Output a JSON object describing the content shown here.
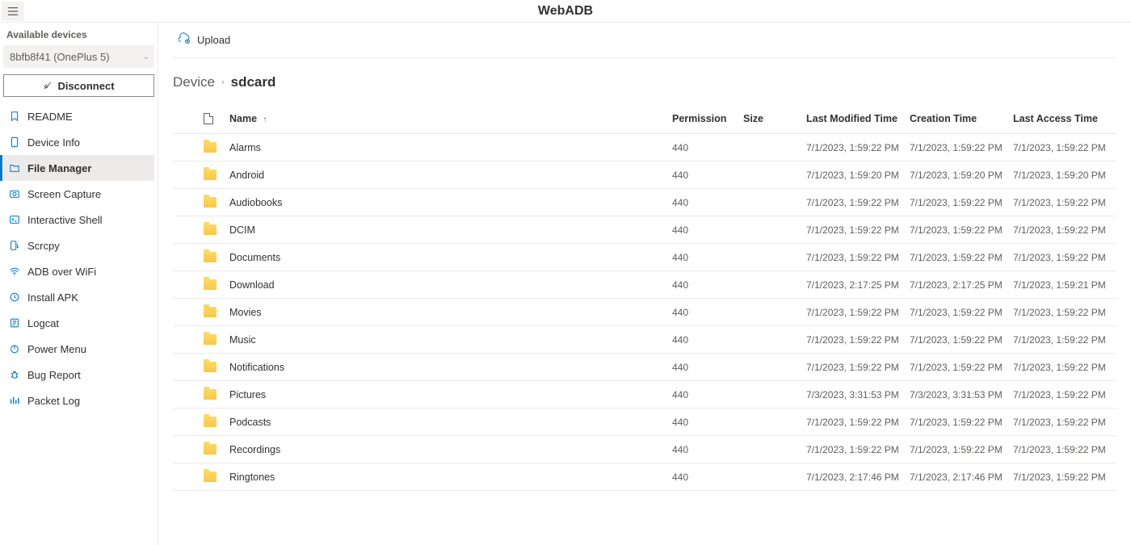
{
  "header": {
    "title": "WebADB"
  },
  "sidebar": {
    "available_label": "Available devices",
    "selected_device": "8bfb8f41 (OnePlus 5)",
    "disconnect_label": "Disconnect",
    "nav": [
      {
        "id": "readme",
        "label": "README",
        "icon": "bookmark-icon"
      },
      {
        "id": "device-info",
        "label": "Device Info",
        "icon": "phone-icon"
      },
      {
        "id": "file-manager",
        "label": "File Manager",
        "icon": "folder-icon",
        "active": true
      },
      {
        "id": "screen-capture",
        "label": "Screen Capture",
        "icon": "camera-icon"
      },
      {
        "id": "interactive-shell",
        "label": "Interactive Shell",
        "icon": "terminal-icon"
      },
      {
        "id": "scrcpy",
        "label": "Scrcpy",
        "icon": "phone-link-icon"
      },
      {
        "id": "adb-over-wifi",
        "label": "ADB over WiFi",
        "icon": "wifi-icon"
      },
      {
        "id": "install-apk",
        "label": "Install APK",
        "icon": "package-icon"
      },
      {
        "id": "logcat",
        "label": "Logcat",
        "icon": "log-icon"
      },
      {
        "id": "power-menu",
        "label": "Power Menu",
        "icon": "power-icon"
      },
      {
        "id": "bug-report",
        "label": "Bug Report",
        "icon": "bug-icon"
      },
      {
        "id": "packet-log",
        "label": "Packet Log",
        "icon": "network-icon"
      }
    ]
  },
  "toolbar": {
    "upload_label": "Upload"
  },
  "breadcrumb": {
    "root_label": "Device",
    "current_label": "sdcard"
  },
  "table": {
    "columns": {
      "name": "Name",
      "permission": "Permission",
      "size": "Size",
      "last_modified": "Last Modified Time",
      "creation": "Creation Time",
      "last_access": "Last Access Time"
    },
    "rows": [
      {
        "name": "Alarms",
        "permission": "440",
        "size": "",
        "lastModified": "7/1/2023, 1:59:22 PM",
        "creation": "7/1/2023, 1:59:22 PM",
        "lastAccess": "7/1/2023, 1:59:22 PM"
      },
      {
        "name": "Android",
        "permission": "440",
        "size": "",
        "lastModified": "7/1/2023, 1:59:20 PM",
        "creation": "7/1/2023, 1:59:20 PM",
        "lastAccess": "7/1/2023, 1:59:20 PM"
      },
      {
        "name": "Audiobooks",
        "permission": "440",
        "size": "",
        "lastModified": "7/1/2023, 1:59:22 PM",
        "creation": "7/1/2023, 1:59:22 PM",
        "lastAccess": "7/1/2023, 1:59:22 PM"
      },
      {
        "name": "DCIM",
        "permission": "440",
        "size": "",
        "lastModified": "7/1/2023, 1:59:22 PM",
        "creation": "7/1/2023, 1:59:22 PM",
        "lastAccess": "7/1/2023, 1:59:22 PM"
      },
      {
        "name": "Documents",
        "permission": "440",
        "size": "",
        "lastModified": "7/1/2023, 1:59:22 PM",
        "creation": "7/1/2023, 1:59:22 PM",
        "lastAccess": "7/1/2023, 1:59:22 PM"
      },
      {
        "name": "Download",
        "permission": "440",
        "size": "",
        "lastModified": "7/1/2023, 2:17:25 PM",
        "creation": "7/1/2023, 2:17:25 PM",
        "lastAccess": "7/1/2023, 1:59:21 PM"
      },
      {
        "name": "Movies",
        "permission": "440",
        "size": "",
        "lastModified": "7/1/2023, 1:59:22 PM",
        "creation": "7/1/2023, 1:59:22 PM",
        "lastAccess": "7/1/2023, 1:59:22 PM"
      },
      {
        "name": "Music",
        "permission": "440",
        "size": "",
        "lastModified": "7/1/2023, 1:59:22 PM",
        "creation": "7/1/2023, 1:59:22 PM",
        "lastAccess": "7/1/2023, 1:59:22 PM"
      },
      {
        "name": "Notifications",
        "permission": "440",
        "size": "",
        "lastModified": "7/1/2023, 1:59:22 PM",
        "creation": "7/1/2023, 1:59:22 PM",
        "lastAccess": "7/1/2023, 1:59:22 PM"
      },
      {
        "name": "Pictures",
        "permission": "440",
        "size": "",
        "lastModified": "7/3/2023, 3:31:53 PM",
        "creation": "7/3/2023, 3:31:53 PM",
        "lastAccess": "7/1/2023, 1:59:22 PM"
      },
      {
        "name": "Podcasts",
        "permission": "440",
        "size": "",
        "lastModified": "7/1/2023, 1:59:22 PM",
        "creation": "7/1/2023, 1:59:22 PM",
        "lastAccess": "7/1/2023, 1:59:22 PM"
      },
      {
        "name": "Recordings",
        "permission": "440",
        "size": "",
        "lastModified": "7/1/2023, 1:59:22 PM",
        "creation": "7/1/2023, 1:59:22 PM",
        "lastAccess": "7/1/2023, 1:59:22 PM"
      },
      {
        "name": "Ringtones",
        "permission": "440",
        "size": "",
        "lastModified": "7/1/2023, 2:17:46 PM",
        "creation": "7/1/2023, 2:17:46 PM",
        "lastAccess": "7/1/2023, 1:59:22 PM"
      }
    ]
  }
}
